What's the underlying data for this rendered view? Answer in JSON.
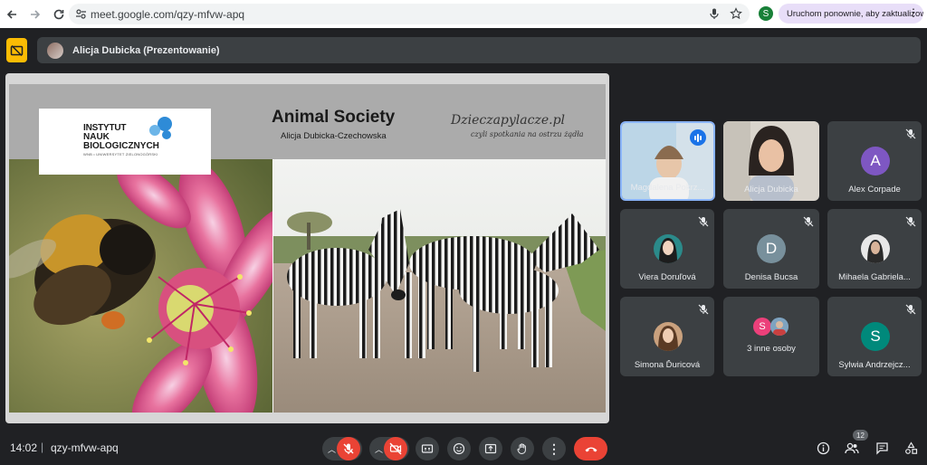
{
  "browser": {
    "url": "meet.google.com/qzy-mfvw-apq",
    "profile_initial": "S",
    "update_label": "Uruchom ponownie, aby zaktualizować"
  },
  "banner": {
    "presenter_label": "Alicja Dubicka (Prezentowanie)"
  },
  "slide": {
    "logo_line1": "INSTYTUT",
    "logo_line2": "NAUK",
    "logo_line3": "BIOLOGICZNYCH",
    "logo_sub": "WNB • UNIWERSYTET ZIELONOGÓRSKI",
    "title": "Animal Society",
    "subtitle": "Alicja Dubicka-Czechowska",
    "brand": "Dzieczapylacze.pl",
    "brand_sub": "czyli spotkania na ostrzu żądła"
  },
  "participants": [
    {
      "name": "Magdalena Pokrz...",
      "type": "video",
      "speaking": true
    },
    {
      "name": "Alicja Dubicka",
      "type": "video",
      "speaking": false
    },
    {
      "name": "Alex Corpade",
      "type": "letter",
      "initial": "A",
      "color": "#7e57c2"
    },
    {
      "name": "Viera Doruľová",
      "type": "photo"
    },
    {
      "name": "Denisa Bucsa",
      "type": "letter",
      "initial": "D",
      "color": "#78909c"
    },
    {
      "name": "Mihaela Gabriela...",
      "type": "photo"
    },
    {
      "name": "Simona Ďuricová",
      "type": "photo"
    },
    {
      "name": "3 inne osoby",
      "type": "group",
      "initial": "S",
      "color": "#ec407a"
    },
    {
      "name": "Sylwia Andrzejcz...",
      "type": "letter",
      "initial": "S",
      "color": "#00897b"
    }
  ],
  "bottom": {
    "time": "14:02",
    "separator": "|",
    "meeting_code": "qzy-mfvw-apq",
    "people_count": "12"
  },
  "colors": {
    "accent_blue": "#1a73e8",
    "danger_red": "#ea4335",
    "present_yellow": "#fbbc04",
    "tile_bg": "#3c4043",
    "bg": "#202124"
  }
}
